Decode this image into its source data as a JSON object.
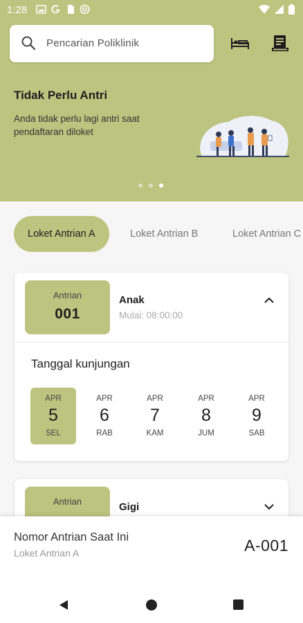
{
  "status_bar": {
    "time": "1:28"
  },
  "search": {
    "placeholder": "Pencarian Poliklinik"
  },
  "header_icons": [
    "bed-icon",
    "receipt-icon"
  ],
  "banner": {
    "title": "Tidak Perlu Antri",
    "description": "Anda tidak perlu lagi antri saat pendaftaran diloket",
    "slide_count": 3,
    "active_slide": 3
  },
  "tabs": [
    {
      "label": "Loket Antrian A",
      "active": true
    },
    {
      "label": "Loket Antrian B",
      "active": false
    },
    {
      "label": "Loket Antrian C",
      "active": false
    }
  ],
  "cards": [
    {
      "queue_label": "Antrian",
      "queue_number": "001",
      "service": "Anak",
      "start": "Mulai: 08:00:00",
      "expanded": true,
      "date_heading": "Tanggal kunjungan",
      "dates": [
        {
          "month": "APR",
          "day": "5",
          "weekday": "SEL",
          "selected": true
        },
        {
          "month": "APR",
          "day": "6",
          "weekday": "RAB",
          "selected": false
        },
        {
          "month": "APR",
          "day": "7",
          "weekday": "KAM",
          "selected": false
        },
        {
          "month": "APR",
          "day": "8",
          "weekday": "JUM",
          "selected": false
        },
        {
          "month": "APR",
          "day": "9",
          "weekday": "SAB",
          "selected": false
        }
      ]
    },
    {
      "queue_label": "Antrian",
      "service": "Gigi",
      "expanded": false
    }
  ],
  "current_queue": {
    "title": "Nomor Antrian Saat Ini",
    "counter": "Loket Antrian A",
    "number": "A-001"
  },
  "colors": {
    "accent": "#bcc47f",
    "background": "#f6f6f6",
    "card": "#ffffff"
  }
}
